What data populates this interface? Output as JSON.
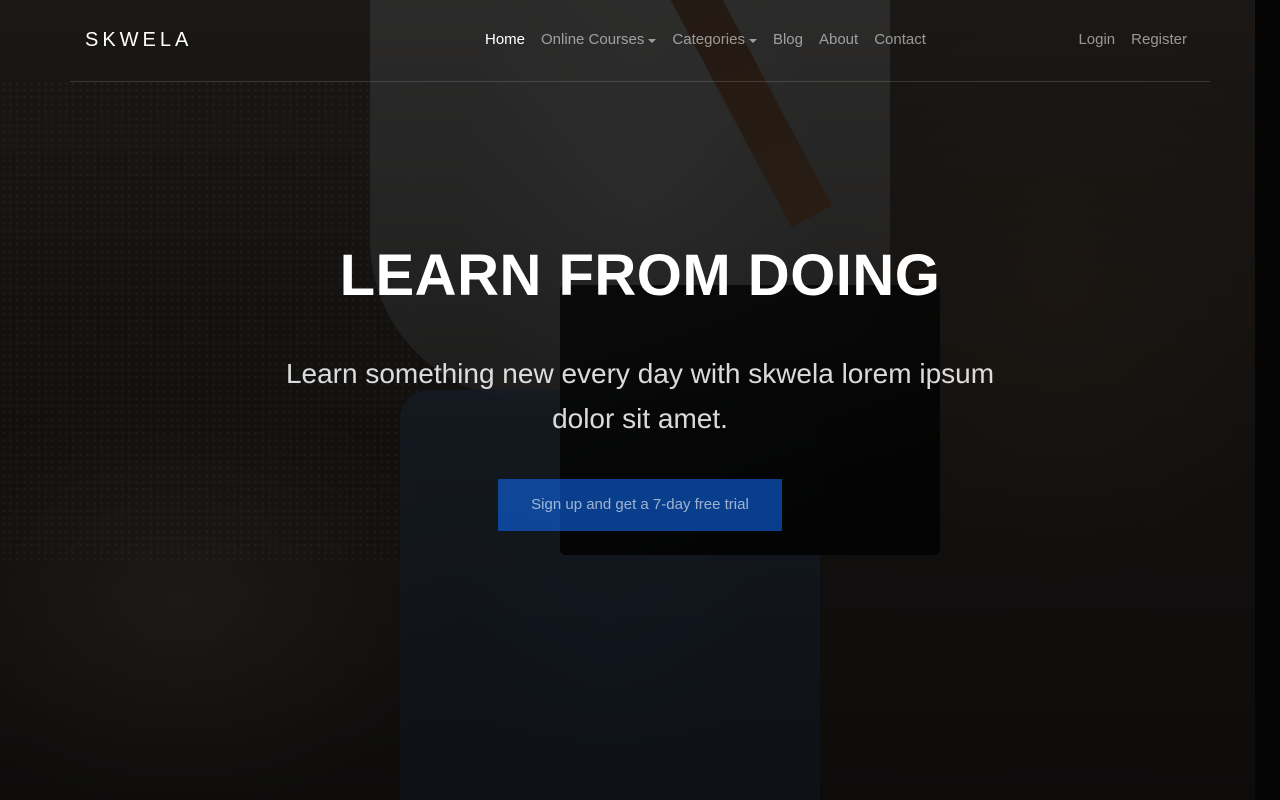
{
  "brand": {
    "name": "SKWELA"
  },
  "nav": {
    "items": [
      {
        "label": "Home",
        "active": true,
        "dropdown": false
      },
      {
        "label": "Online Courses",
        "active": false,
        "dropdown": true
      },
      {
        "label": "Categories",
        "active": false,
        "dropdown": true
      },
      {
        "label": "Blog",
        "active": false,
        "dropdown": false
      },
      {
        "label": "About",
        "active": false,
        "dropdown": false
      },
      {
        "label": "Contact",
        "active": false,
        "dropdown": false
      }
    ],
    "auth": {
      "login": "Login",
      "register": "Register"
    }
  },
  "hero": {
    "title": "LEARN FROM DOING",
    "subtitle": "Learn something new every day with skwela lorem ipsum dolor sit amet.",
    "cta_label": "Sign up and get a 7-day free trial"
  },
  "colors": {
    "accent": "#0d6efd",
    "nav_text": "#9a9a9a",
    "nav_active": "#ffffff"
  }
}
